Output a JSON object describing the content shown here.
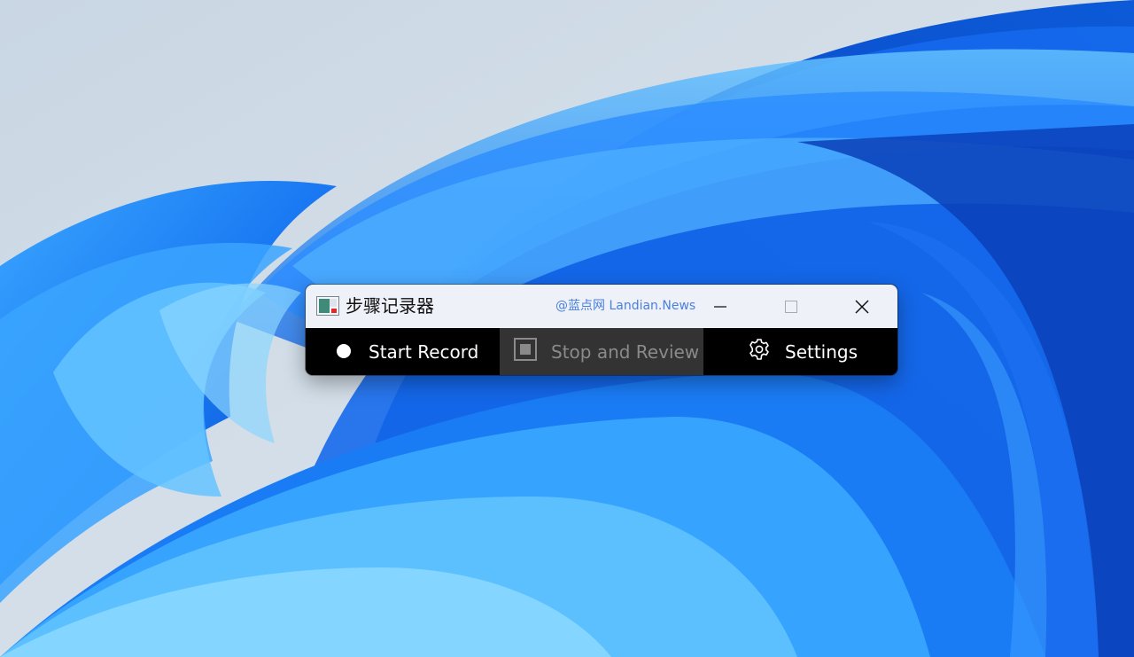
{
  "window": {
    "title": "步骤记录器",
    "watermark": "@蓝点网 Landian.News"
  },
  "controls": {
    "minimize": "minimize-icon",
    "maximize": "maximize-icon",
    "close": "close-icon"
  },
  "toolbar": {
    "start_label": "Start Record",
    "stop_label": "Stop and Review",
    "settings_label": "Settings"
  },
  "state": {
    "stop_and_review_enabled": false
  },
  "colors": {
    "titlebar": "#eef1f8",
    "toolbar": "#000000",
    "disabled_button_bg": "#333333",
    "disabled_text": "#8a8a8a",
    "watermark": "#4a7fe0",
    "wallpaper_blue": "#0a5ed8"
  }
}
